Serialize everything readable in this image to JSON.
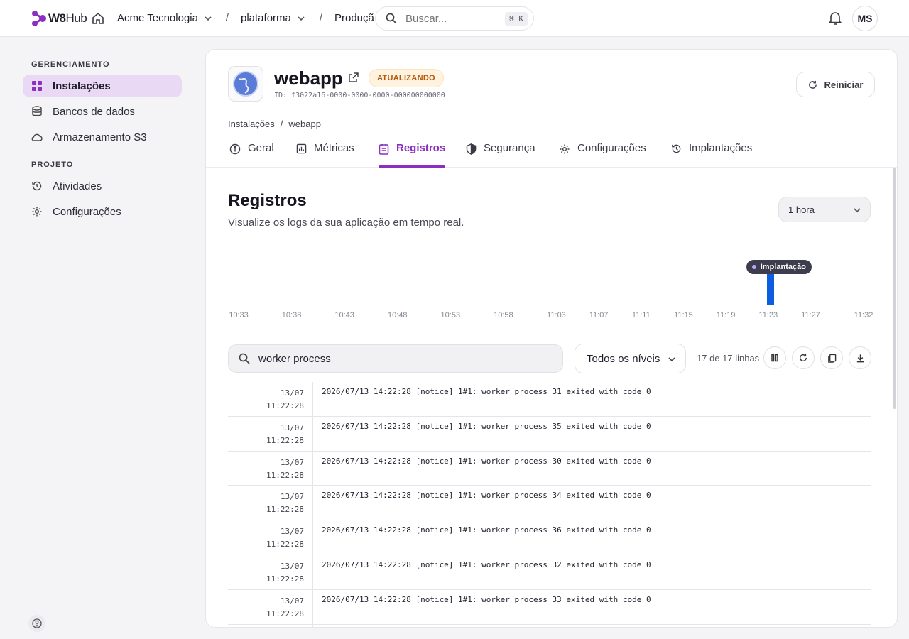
{
  "brand": {
    "name_bold": "W8",
    "name_light": "Hub",
    "accent": "#8a2fc2"
  },
  "topbar": {
    "org": "Acme Tecnologia",
    "project": "plataforma",
    "environment": "Produçã",
    "separator": "/",
    "search_placeholder": "Buscar...",
    "search_shortcut": "⌘ K",
    "user_initials": "MS"
  },
  "sidebar": {
    "section_manage": "GERENCIAMENTO",
    "section_project": "PROJETO",
    "items": [
      {
        "label": "Instalações",
        "icon": "grid-icon",
        "active": true
      },
      {
        "label": "Bancos de dados",
        "icon": "database-icon"
      },
      {
        "label": "Armazenamento S3",
        "icon": "cloud-icon"
      },
      {
        "label": "Atividades",
        "icon": "history-icon"
      },
      {
        "label": "Configurações",
        "icon": "gear-icon"
      }
    ]
  },
  "app": {
    "name": "webapp",
    "status": "ATUALIZANDO",
    "status_color": "#b4590a",
    "id": "ID: f3022a16-0000-0000-0000-000000000000",
    "restart_label": "Reiniciar",
    "breadcrumb_root": "Instalações",
    "breadcrumb_sep": "/",
    "breadcrumb_current": "webapp"
  },
  "tabs": [
    {
      "label": "Geral",
      "icon": "info-icon"
    },
    {
      "label": "Métricas",
      "icon": "chart-icon"
    },
    {
      "label": "Registros",
      "icon": "logs-icon",
      "active": true
    },
    {
      "label": "Segurança",
      "icon": "shield-icon"
    },
    {
      "label": "Configurações",
      "icon": "gear-icon"
    },
    {
      "label": "Implantações",
      "icon": "history-icon"
    }
  ],
  "logs": {
    "title": "Registros",
    "subtitle": "Visualize os logs da sua aplicação em tempo real.",
    "range": "1 hora",
    "filter_value": "worker process",
    "level": "Todos os níveis",
    "line_count": "17 de 17 linhas",
    "rows": [
      {
        "date": "13/07",
        "time": "11:22:28",
        "message": "2026/07/13 14:22:28 [notice] 1#1: worker process 31 exited with code 0"
      },
      {
        "date": "13/07",
        "time": "11:22:28",
        "message": "2026/07/13 14:22:28 [notice] 1#1: worker process 35 exited with code 0"
      },
      {
        "date": "13/07",
        "time": "11:22:28",
        "message": "2026/07/13 14:22:28 [notice] 1#1: worker process 30 exited with code 0"
      },
      {
        "date": "13/07",
        "time": "11:22:28",
        "message": "2026/07/13 14:22:28 [notice] 1#1: worker process 34 exited with code 0"
      },
      {
        "date": "13/07",
        "time": "11:22:28",
        "message": "2026/07/13 14:22:28 [notice] 1#1: worker process 36 exited with code 0"
      },
      {
        "date": "13/07",
        "time": "11:22:28",
        "message": "2026/07/13 14:22:28 [notice] 1#1: worker process 32 exited with code 0"
      },
      {
        "date": "13/07",
        "time": "11:22:28",
        "message": "2026/07/13 14:22:28 [notice] 1#1: worker process 33 exited with code 0"
      },
      {
        "date": "",
        "time": "",
        "message": ""
      }
    ]
  },
  "chart_data": {
    "type": "bar",
    "x_ticks": [
      "10:33",
      "10:38",
      "10:43",
      "10:48",
      "10:53",
      "10:58",
      "11:03",
      "11:07",
      "11:11",
      "11:15",
      "11:19",
      "11:23",
      "11:27",
      "11:32"
    ],
    "series": [
      {
        "x": [
          "11:22"
        ],
        "values": [
          17
        ],
        "color": "#0d5de0"
      }
    ],
    "annotation": {
      "label": "Implantação",
      "at": "11:23"
    },
    "ylim": [
      0,
      17
    ],
    "grid": false
  }
}
